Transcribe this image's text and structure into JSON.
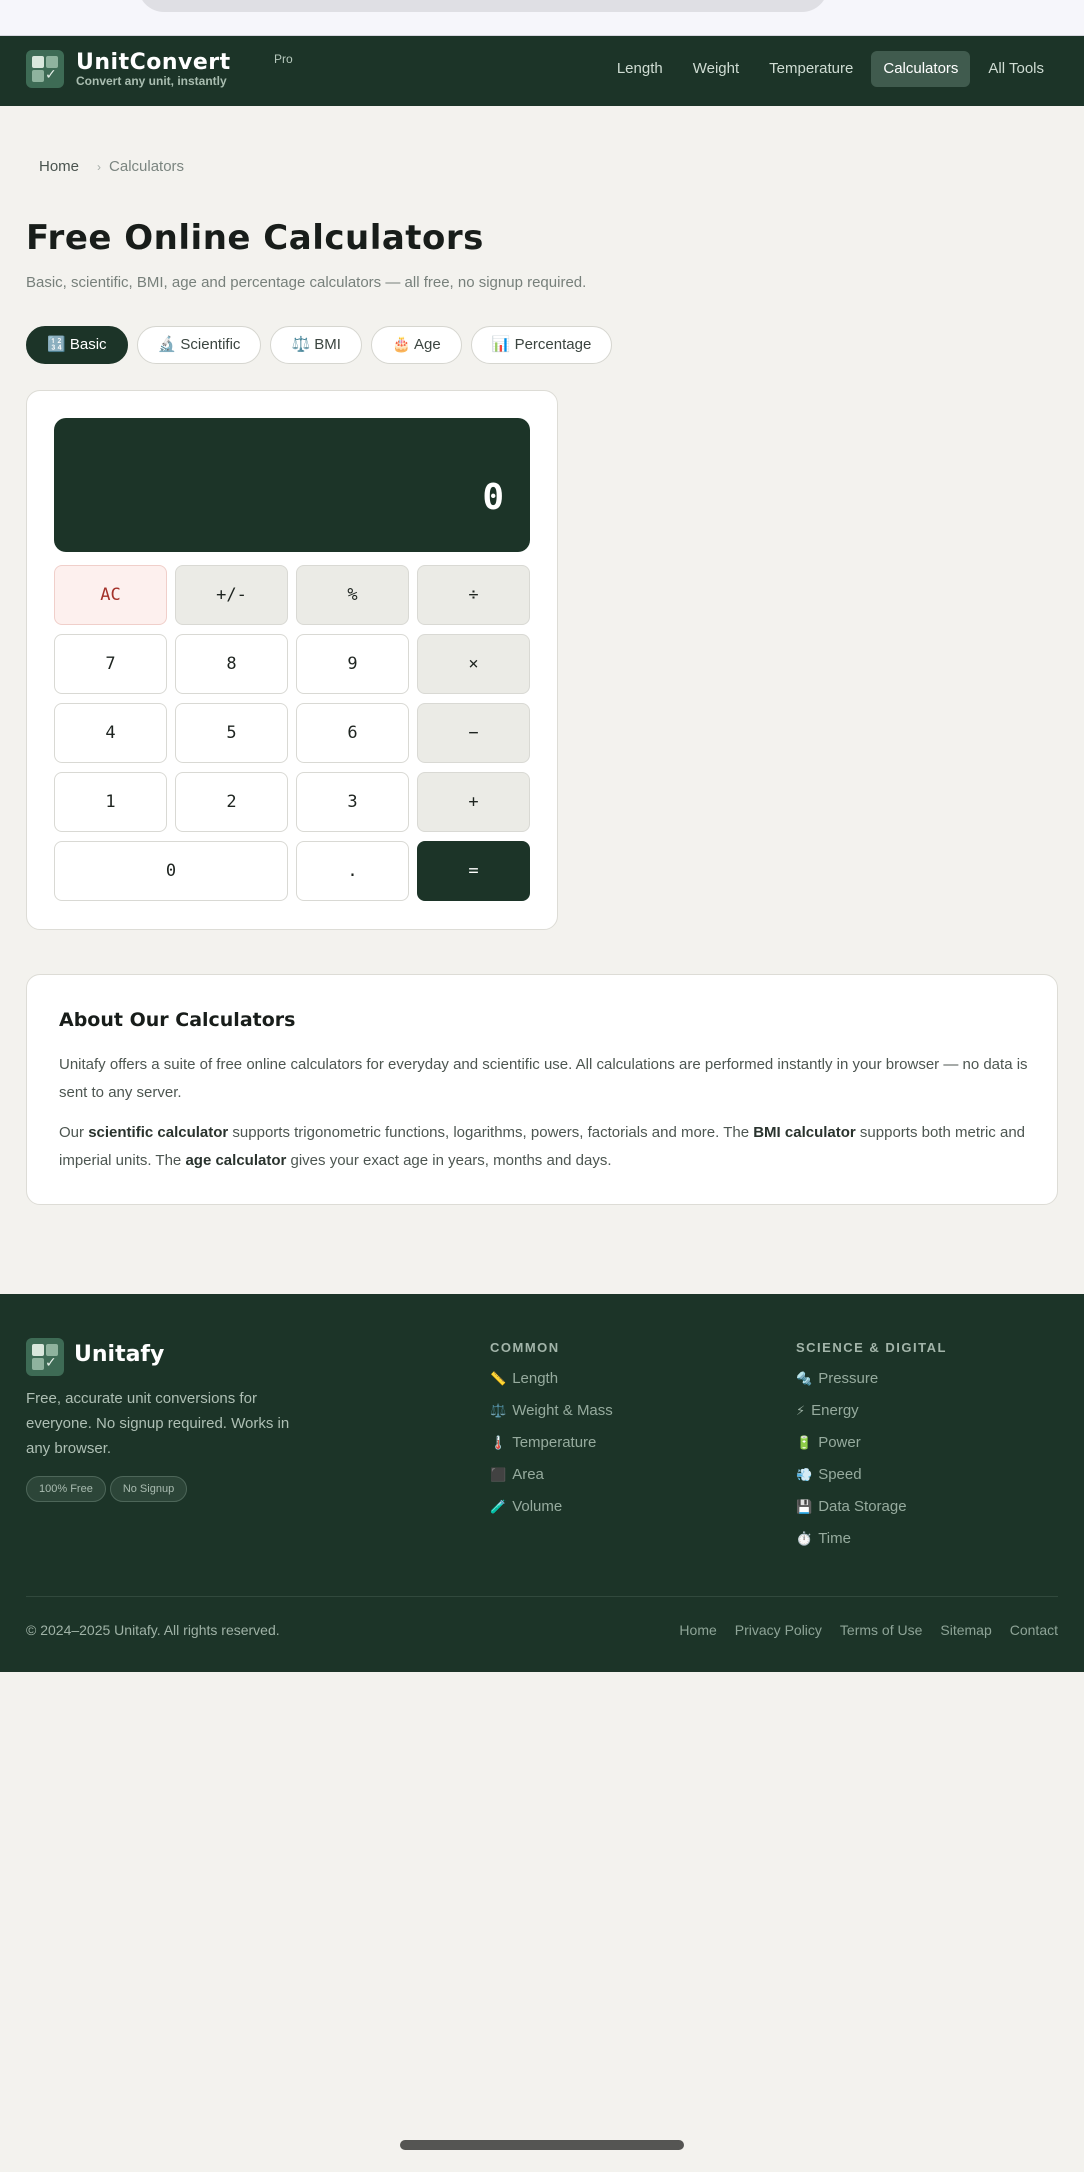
{
  "header": {
    "brand": "UnitConvert",
    "brand_badge": "Pro",
    "tagline": "Convert any unit, instantly",
    "nav": [
      {
        "label": "Length",
        "active": false
      },
      {
        "label": "Weight",
        "active": false
      },
      {
        "label": "Temperature",
        "active": false
      },
      {
        "label": "Calculators",
        "active": true
      },
      {
        "label": "All Tools",
        "active": false
      }
    ]
  },
  "breadcrumb": {
    "home": "Home",
    "separator": "›",
    "current": "Calculators"
  },
  "page": {
    "title": "Free Online Calculators",
    "subtitle": "Basic, scientific, BMI, age and percentage calculators — all free, no signup required."
  },
  "tabs": [
    {
      "icon": "🔢",
      "label": "Basic",
      "active": true
    },
    {
      "icon": "🔬",
      "label": "Scientific",
      "active": false
    },
    {
      "icon": "⚖️",
      "label": "BMI",
      "active": false
    },
    {
      "icon": "🎂",
      "label": "Age",
      "active": false
    },
    {
      "icon": "📊",
      "label": "Percentage",
      "active": false
    }
  ],
  "calculator": {
    "display": "0",
    "keys": {
      "ac": "AC",
      "sign": "+/-",
      "percent": "%",
      "divide": "÷",
      "d7": "7",
      "d8": "8",
      "d9": "9",
      "multiply": "×",
      "d4": "4",
      "d5": "5",
      "d6": "6",
      "minus": "−",
      "d1": "1",
      "d2": "2",
      "d3": "3",
      "plus": "+",
      "d0": "0",
      "dot": ".",
      "equals": "="
    }
  },
  "about": {
    "title": "About Our Calculators",
    "p1": "Unitafy offers a suite of free online calculators for everyday and scientific use. All calculations are performed instantly in your browser — no data is sent to any server.",
    "p2_a": "Our ",
    "p2_b": "scientific calculator",
    "p2_c": " supports trigonometric functions, logarithms, powers, factorials and more. The ",
    "p2_d": "BMI calculator",
    "p2_e": " supports both metric and imperial units. The ",
    "p2_f": "age calculator",
    "p2_g": " gives your exact age in years, months and days."
  },
  "footer": {
    "brand": "Unitafy",
    "description": "Free, accurate unit conversions for everyone. No signup required. Works in any browser.",
    "badges": [
      "100% Free",
      "No Signup"
    ],
    "common": {
      "heading": "COMMON",
      "items": [
        {
          "icon": "📏",
          "label": "Length"
        },
        {
          "icon": "⚖️",
          "label": "Weight & Mass"
        },
        {
          "icon": "🌡️",
          "label": "Temperature"
        },
        {
          "icon": "⬛",
          "label": "Area"
        },
        {
          "icon": "🧪",
          "label": "Volume"
        }
      ]
    },
    "science": {
      "heading": "SCIENCE & DIGITAL",
      "items": [
        {
          "icon": "🔩",
          "label": "Pressure"
        },
        {
          "icon": "⚡",
          "label": "Energy"
        },
        {
          "icon": "🔋",
          "label": "Power"
        },
        {
          "icon": "💨",
          "label": "Speed"
        },
        {
          "icon": "💾",
          "label": "Data Storage"
        },
        {
          "icon": "⏱️",
          "label": "Time"
        }
      ]
    },
    "copyright": "© 2024–2025 Unitafy. All rights reserved.",
    "links": [
      "Home",
      "Privacy Policy",
      "Terms of Use",
      "Sitemap",
      "Contact"
    ]
  }
}
